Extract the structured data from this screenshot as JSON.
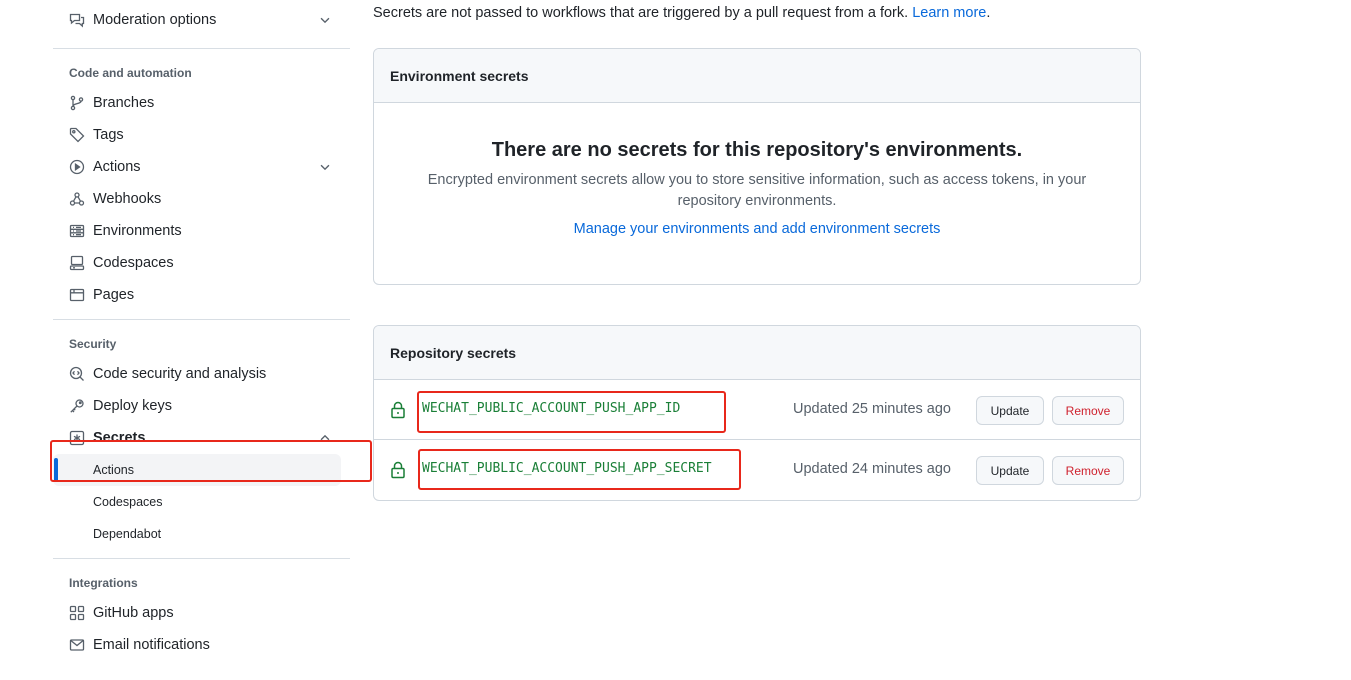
{
  "sidebar": {
    "top_item": {
      "label": "Moderation options",
      "icon": "comment-discussion-icon"
    },
    "groups": [
      {
        "title": "Code and automation",
        "items": [
          {
            "label": "Branches",
            "icon": "git-branch-icon"
          },
          {
            "label": "Tags",
            "icon": "tag-icon"
          },
          {
            "label": "Actions",
            "icon": "play-icon"
          },
          {
            "label": "Webhooks",
            "icon": "webhook-icon"
          },
          {
            "label": "Environments",
            "icon": "server-icon"
          },
          {
            "label": "Codespaces",
            "icon": "codespaces-icon"
          },
          {
            "label": "Pages",
            "icon": "browser-icon"
          }
        ]
      },
      {
        "title": "Security",
        "items": [
          {
            "label": "Code security and analysis",
            "icon": "codescan-icon"
          },
          {
            "label": "Deploy keys",
            "icon": "key-icon"
          },
          {
            "label": "Secrets",
            "icon": "key-asterisk-icon"
          }
        ],
        "secrets_sub": [
          {
            "label": "Actions",
            "active": true
          },
          {
            "label": "Codespaces",
            "active": false
          },
          {
            "label": "Dependabot",
            "active": false
          }
        ]
      },
      {
        "title": "Integrations",
        "items": [
          {
            "label": "GitHub apps",
            "icon": "apps-icon"
          },
          {
            "label": "Email notifications",
            "icon": "mail-icon"
          }
        ]
      }
    ]
  },
  "main": {
    "note_text": "Secrets are not passed to workflows that are triggered by a pull request from a fork.",
    "note_link": "Learn more",
    "note_end": ".",
    "env_secrets": {
      "header": "Environment secrets",
      "blank_title": "There are no secrets for this repository's environments.",
      "blank_desc": "Encrypted environment secrets allow you to store sensitive information, such as access tokens, in your repository environments.",
      "blank_link": "Manage your environments and add environment secrets"
    },
    "repo_secrets": {
      "header": "Repository secrets",
      "rows": [
        {
          "name": "WECHAT_PUBLIC_ACCOUNT_PUSH_APP_ID",
          "updated": "Updated 25 minutes ago",
          "update_label": "Update",
          "remove_label": "Remove"
        },
        {
          "name": "WECHAT_PUBLIC_ACCOUNT_PUSH_APP_SECRET",
          "updated": "Updated 24 minutes ago",
          "update_label": "Update",
          "remove_label": "Remove"
        }
      ]
    }
  },
  "colors": {
    "accent": "#0969da",
    "secret_green": "#1a7f37",
    "danger": "#cf222e",
    "highlight_red": "#e8281b"
  }
}
